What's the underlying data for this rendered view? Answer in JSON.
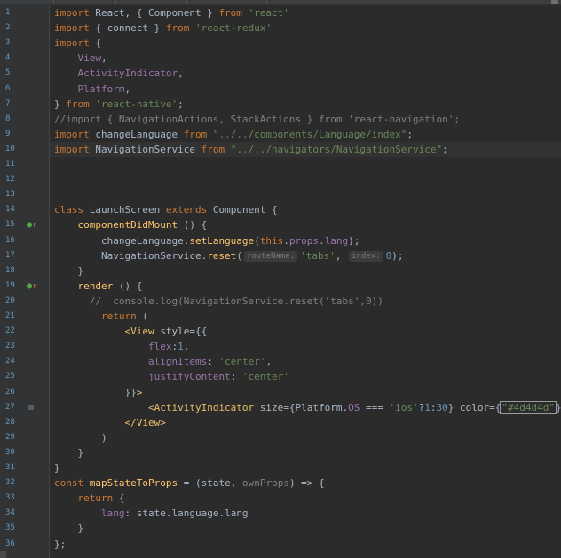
{
  "editor": {
    "lines": [
      {
        "n": "1",
        "marker": "",
        "tokens": [
          [
            "kw",
            "import "
          ],
          [
            "",
            "React, { Component } "
          ],
          [
            "kw",
            "from "
          ],
          [
            "str",
            "'react'"
          ]
        ]
      },
      {
        "n": "2",
        "marker": "",
        "tokens": [
          [
            "kw",
            "import "
          ],
          [
            "",
            "{ connect } "
          ],
          [
            "kw",
            "from "
          ],
          [
            "str",
            "'react-redux'"
          ]
        ]
      },
      {
        "n": "3",
        "marker": "",
        "tokens": [
          [
            "kw",
            "import "
          ],
          [
            "",
            "{"
          ]
        ]
      },
      {
        "n": "4",
        "marker": "",
        "tokens": [
          [
            "prop",
            "    View"
          ],
          [
            "",
            ","
          ]
        ]
      },
      {
        "n": "5",
        "marker": "",
        "tokens": [
          [
            "prop",
            "    ActivityIndicator"
          ],
          [
            "",
            ","
          ]
        ]
      },
      {
        "n": "6",
        "marker": "",
        "tokens": [
          [
            "prop",
            "    Platform"
          ],
          [
            "",
            ","
          ]
        ]
      },
      {
        "n": "7",
        "marker": "",
        "tokens": [
          [
            "",
            "} "
          ],
          [
            "kw",
            "from "
          ],
          [
            "str",
            "'react-native'"
          ],
          [
            "",
            ";"
          ]
        ]
      },
      {
        "n": "8",
        "marker": "",
        "tokens": [
          [
            "cm",
            "//import { NavigationActions, StackActions } from 'react-navigation';"
          ]
        ]
      },
      {
        "n": "9",
        "marker": "",
        "tokens": [
          [
            "kw",
            "import "
          ],
          [
            "",
            "changeLanguage "
          ],
          [
            "kw",
            "from "
          ],
          [
            "str",
            "\"../../components/Language/index\""
          ],
          [
            "",
            ";"
          ]
        ]
      },
      {
        "n": "10",
        "marker": "",
        "current": true,
        "tokens": [
          [
            "kw",
            "import "
          ],
          [
            "",
            "NavigationService "
          ],
          [
            "kw",
            "from "
          ],
          [
            "str",
            "\"../../navigators/NavigationService\""
          ],
          [
            "",
            ";"
          ]
        ]
      },
      {
        "n": "11",
        "marker": "",
        "tokens": []
      },
      {
        "n": "12",
        "marker": "",
        "tokens": []
      },
      {
        "n": "13",
        "marker": "",
        "tokens": []
      },
      {
        "n": "14",
        "marker": "",
        "tokens": [
          [
            "kw",
            "class "
          ],
          [
            "",
            "LaunchScreen "
          ],
          [
            "kw",
            "extends "
          ],
          [
            "",
            "Component {"
          ]
        ]
      },
      {
        "n": "15",
        "marker": "override",
        "tokens": [
          [
            "",
            "    "
          ],
          [
            "fn",
            "componentDidMount"
          ],
          [
            "",
            " () {"
          ]
        ]
      },
      {
        "n": "16",
        "marker": "",
        "tokens": [
          [
            "",
            "        changeLanguage."
          ],
          [
            "fn",
            "setLanguage"
          ],
          [
            "",
            "("
          ],
          [
            "kw",
            "this"
          ],
          [
            "",
            "."
          ],
          [
            "prop",
            "props"
          ],
          [
            "",
            "."
          ],
          [
            "prop",
            "lang"
          ],
          [
            "",
            ");"
          ]
        ]
      },
      {
        "n": "17",
        "marker": "",
        "tokens": [
          [
            "",
            "        NavigationService."
          ],
          [
            "fn",
            "reset"
          ],
          [
            "",
            "("
          ],
          [
            "hint",
            "routeName:"
          ],
          [
            "str",
            "'tabs'"
          ],
          [
            "",
            ", "
          ],
          [
            "hint",
            "index:"
          ],
          [
            "num",
            "0"
          ],
          [
            "",
            ");"
          ]
        ]
      },
      {
        "n": "18",
        "marker": "",
        "tokens": [
          [
            "",
            "    }"
          ]
        ]
      },
      {
        "n": "19",
        "marker": "override",
        "tokens": [
          [
            "",
            "    "
          ],
          [
            "fn",
            "render"
          ],
          [
            "",
            " () {"
          ]
        ]
      },
      {
        "n": "20",
        "marker": "",
        "tokens": [
          [
            "cm",
            "      //  console.log(NavigationService.reset('tabs',0))"
          ]
        ]
      },
      {
        "n": "21",
        "marker": "",
        "tokens": [
          [
            "",
            "        "
          ],
          [
            "kw",
            "return"
          ],
          [
            "",
            " ("
          ]
        ]
      },
      {
        "n": "22",
        "marker": "",
        "tokens": [
          [
            "",
            "            "
          ],
          [
            "tag",
            "<View "
          ],
          [
            "attr",
            "style"
          ],
          [
            "",
            "={{"
          ]
        ]
      },
      {
        "n": "23",
        "marker": "",
        "tokens": [
          [
            "",
            "                "
          ],
          [
            "prop",
            "flex"
          ],
          [
            "",
            ":"
          ],
          [
            "num",
            "1"
          ],
          [
            "",
            ","
          ]
        ]
      },
      {
        "n": "24",
        "marker": "",
        "tokens": [
          [
            "",
            "                "
          ],
          [
            "prop",
            "alignItems"
          ],
          [
            "",
            ": "
          ],
          [
            "str",
            "'center'"
          ],
          [
            "",
            ","
          ]
        ]
      },
      {
        "n": "25",
        "marker": "",
        "tokens": [
          [
            "",
            "                "
          ],
          [
            "prop",
            "justifyContent"
          ],
          [
            "",
            ": "
          ],
          [
            "str",
            "'center'"
          ]
        ]
      },
      {
        "n": "26",
        "marker": "",
        "tokens": [
          [
            "",
            "            }}"
          ],
          [
            "tag",
            ">"
          ]
        ]
      },
      {
        "n": "27",
        "marker": "bp",
        "tokens": [
          [
            "",
            "                "
          ],
          [
            "tag",
            "<ActivityIndicator "
          ],
          [
            "attr",
            "size"
          ],
          [
            "",
            "={Platform."
          ],
          [
            "prop",
            "OS"
          ],
          [
            "",
            " === "
          ],
          [
            "str",
            "'ios'"
          ],
          [
            "",
            "?"
          ],
          [
            "num",
            "1"
          ],
          [
            "",
            ":"
          ],
          [
            "num",
            "30"
          ],
          [
            "",
            "} "
          ],
          [
            "attr",
            "color"
          ],
          [
            "",
            "={"
          ],
          [
            "str",
            "\"#4d4d4d\""
          ],
          [
            "",
            "}"
          ],
          [
            "tag",
            "/>"
          ]
        ]
      },
      {
        "n": "28",
        "marker": "",
        "tokens": [
          [
            "",
            "            "
          ],
          [
            "tag",
            "</View>"
          ]
        ]
      },
      {
        "n": "29",
        "marker": "",
        "tokens": [
          [
            "",
            "        )"
          ]
        ]
      },
      {
        "n": "30",
        "marker": "",
        "tokens": [
          [
            "",
            "    }"
          ]
        ]
      },
      {
        "n": "31",
        "marker": "",
        "tokens": [
          [
            "",
            "}"
          ]
        ]
      },
      {
        "n": "32",
        "marker": "",
        "tokens": [
          [
            "kw",
            "const "
          ],
          [
            "fn",
            "mapStateToProps"
          ],
          [
            "",
            " = (state, "
          ],
          [
            "cm",
            "ownProps"
          ],
          [
            "",
            ") => {"
          ]
        ]
      },
      {
        "n": "33",
        "marker": "",
        "tokens": [
          [
            "",
            "    "
          ],
          [
            "kw",
            "return"
          ],
          [
            "",
            " {"
          ]
        ]
      },
      {
        "n": "34",
        "marker": "",
        "tokens": [
          [
            "",
            "        "
          ],
          [
            "prop",
            "lang"
          ],
          [
            "",
            ": state.language.lang"
          ]
        ]
      },
      {
        "n": "35",
        "marker": "",
        "tokens": [
          [
            "",
            "    }"
          ]
        ]
      },
      {
        "n": "36",
        "marker": "",
        "tokens": [
          [
            "",
            "};"
          ]
        ]
      }
    ]
  },
  "colors": {
    "background": "#2b2b2b",
    "gutter": "#313335",
    "keyword": "#cc7832",
    "string": "#6a8759",
    "number": "#6897bb",
    "comment": "#808080",
    "function": "#ffc66d",
    "tag": "#e8bf6a",
    "property": "#9876aa"
  }
}
